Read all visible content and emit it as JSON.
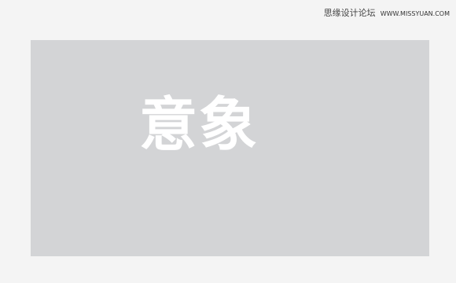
{
  "watermark": {
    "forum_name": "思缘设计论坛",
    "site_url": "WWW.MISSYUAN.COM"
  },
  "canvas": {
    "artwork_text": "意象",
    "background_color": "#d3d4d6",
    "text_color": "#ffffff"
  }
}
